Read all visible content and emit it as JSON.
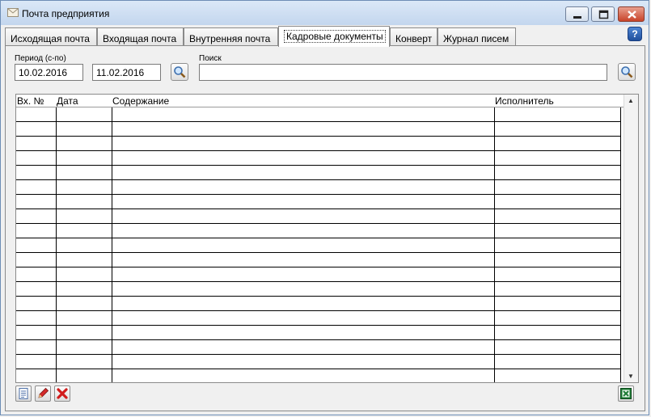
{
  "window": {
    "title": "Почта предприятия"
  },
  "tabs": [
    {
      "label": "Исходящая почта"
    },
    {
      "label": "Входящая почта"
    },
    {
      "label": "Внутренняя почта"
    },
    {
      "label": "Кадровые документы"
    },
    {
      "label": "Конверт"
    },
    {
      "label": "Журнал писем"
    }
  ],
  "active_tab": "Кадровые документы",
  "help": {
    "label": "?"
  },
  "filters": {
    "period_label": "Период (с-по)",
    "date_from": "10.02.2016",
    "date_to": "11.02.2016",
    "search_label": "Поиск",
    "search_value": ""
  },
  "table": {
    "columns": [
      "Вх. №",
      "Дата",
      "Содержание",
      "Исполнитель"
    ],
    "rows": [
      [
        "",
        "",
        "",
        ""
      ],
      [
        "",
        "",
        "",
        ""
      ],
      [
        "",
        "",
        "",
        ""
      ],
      [
        "",
        "",
        "",
        ""
      ],
      [
        "",
        "",
        "",
        ""
      ],
      [
        "",
        "",
        "",
        ""
      ],
      [
        "",
        "",
        "",
        ""
      ],
      [
        "",
        "",
        "",
        ""
      ],
      [
        "",
        "",
        "",
        ""
      ],
      [
        "",
        "",
        "",
        ""
      ],
      [
        "",
        "",
        "",
        ""
      ],
      [
        "",
        "",
        "",
        ""
      ],
      [
        "",
        "",
        "",
        ""
      ],
      [
        "",
        "",
        "",
        ""
      ],
      [
        "",
        "",
        "",
        ""
      ],
      [
        "",
        "",
        "",
        ""
      ],
      [
        "",
        "",
        "",
        ""
      ],
      [
        "",
        "",
        "",
        ""
      ]
    ]
  },
  "icons": {
    "app": "envelope-icon",
    "minimize": "minimize-icon",
    "maximize": "maximize-icon",
    "close": "close-icon",
    "help": "help-icon",
    "search": "magnifier-icon",
    "new": "document-icon",
    "edit": "pencil-icon",
    "delete": "red-x-icon",
    "export": "excel-icon"
  },
  "colors": {
    "titlebar": "#c3d6ee",
    "close_button": "#c8442a",
    "help_button": "#1f4f9c",
    "excel_green": "#1e7b34"
  }
}
